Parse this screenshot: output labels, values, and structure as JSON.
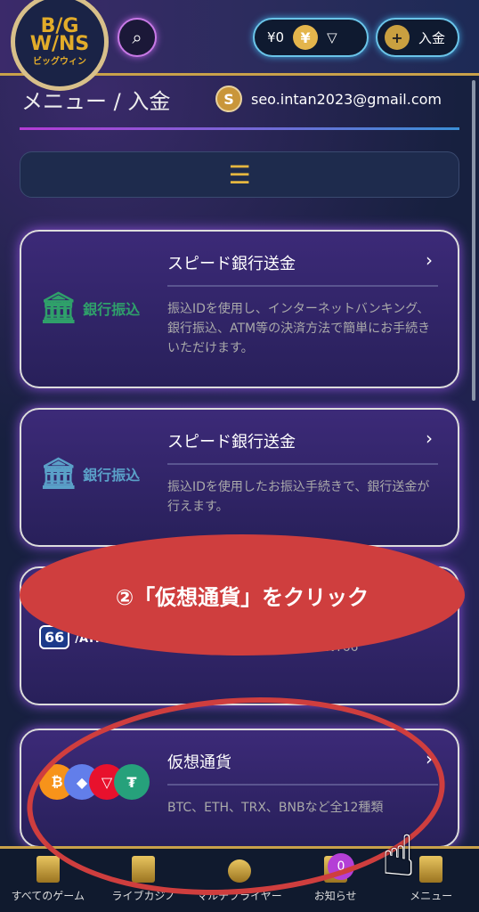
{
  "header": {
    "logo": {
      "line1": "B/G",
      "line2": "W/NS",
      "sub": "ビッグウィン"
    },
    "balance": "¥0",
    "currency_symbol": "¥",
    "deposit_label": "入金"
  },
  "page": {
    "title": "メニュー / 入金",
    "user_initial": "S",
    "user_email": "seo.intan2023@gmail.com"
  },
  "cards": [
    {
      "icon_label": "銀行振込",
      "title": "スピード銀行送金",
      "desc": "振込IDを使用し、インターネットバンキング、銀行振込、ATM等の決済方法で簡単にお手続きいただけます。",
      "color": "#2fa06a"
    },
    {
      "icon_label": "銀行振込",
      "title": "スピード銀行送金",
      "desc": "振込IDを使用したお振込手続きで、銀行送金が行えます。",
      "color": "#5aa0c8"
    },
    {
      "icon_label": "66",
      "icon_sub": "/ATMと入金",
      "desc": "…対応！便利な入出金はPOINT66"
    },
    {
      "title": "仮想通貨",
      "desc": "BTC、ETH、TRX、BNBなど全12種類"
    }
  ],
  "annotation": "②「仮想通貨」をクリック",
  "bottom_nav": [
    {
      "label": "すべてのゲーム"
    },
    {
      "label": "ライブカジノ"
    },
    {
      "label": "マルチプライヤー"
    },
    {
      "label": "お知らせ",
      "badge": "0"
    },
    {
      "label": "メニュー"
    }
  ],
  "colors": {
    "accent_gold": "#c9a14a",
    "annotation_red": "#cf3e3e"
  }
}
